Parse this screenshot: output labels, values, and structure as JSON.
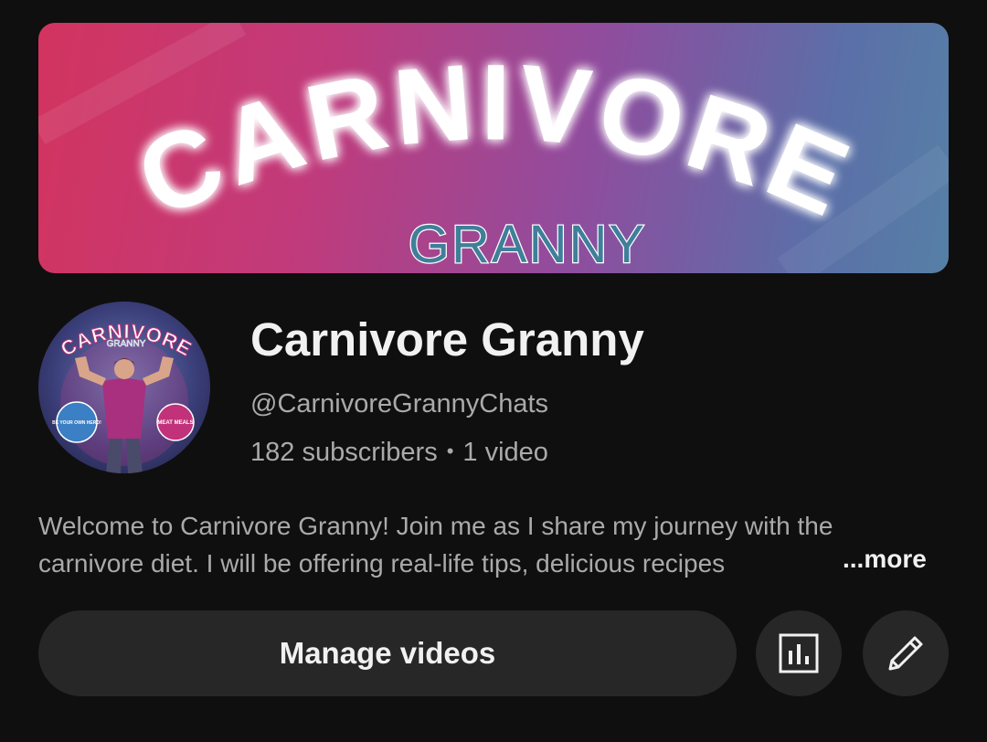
{
  "banner": {
    "title_line1": "CARNIVORE",
    "title_line2": "GRANNY"
  },
  "avatar": {
    "title_line1": "CARNIVORE",
    "title_line2": "GRANNY",
    "badge_left": "BE YOUR OWN HERO!",
    "badge_right": "MEAT MEALS"
  },
  "channel": {
    "name": "Carnivore Granny",
    "handle": "@CarnivoreGrannyChats",
    "subscribers": "182 subscribers",
    "separator": "•",
    "videos": "1 video"
  },
  "description": {
    "line1": "Welcome to Carnivore Granny! Join me as I share my journey with the",
    "line2": "carnivore diet.  I will be offering real-life tips, delicious recipes",
    "more_label": "...more"
  },
  "actions": {
    "manage_label": "Manage videos",
    "analytics_icon": "analytics-icon",
    "edit_icon": "pencil-icon"
  },
  "colors": {
    "background": "#0f0f0f",
    "button_bg": "#272727",
    "text_primary": "#f1f1f1",
    "text_secondary": "#aaaaaa",
    "banner_pink": "#d2345f",
    "banner_blue": "#5680a6",
    "granny_teal": "#3f7f9a"
  }
}
